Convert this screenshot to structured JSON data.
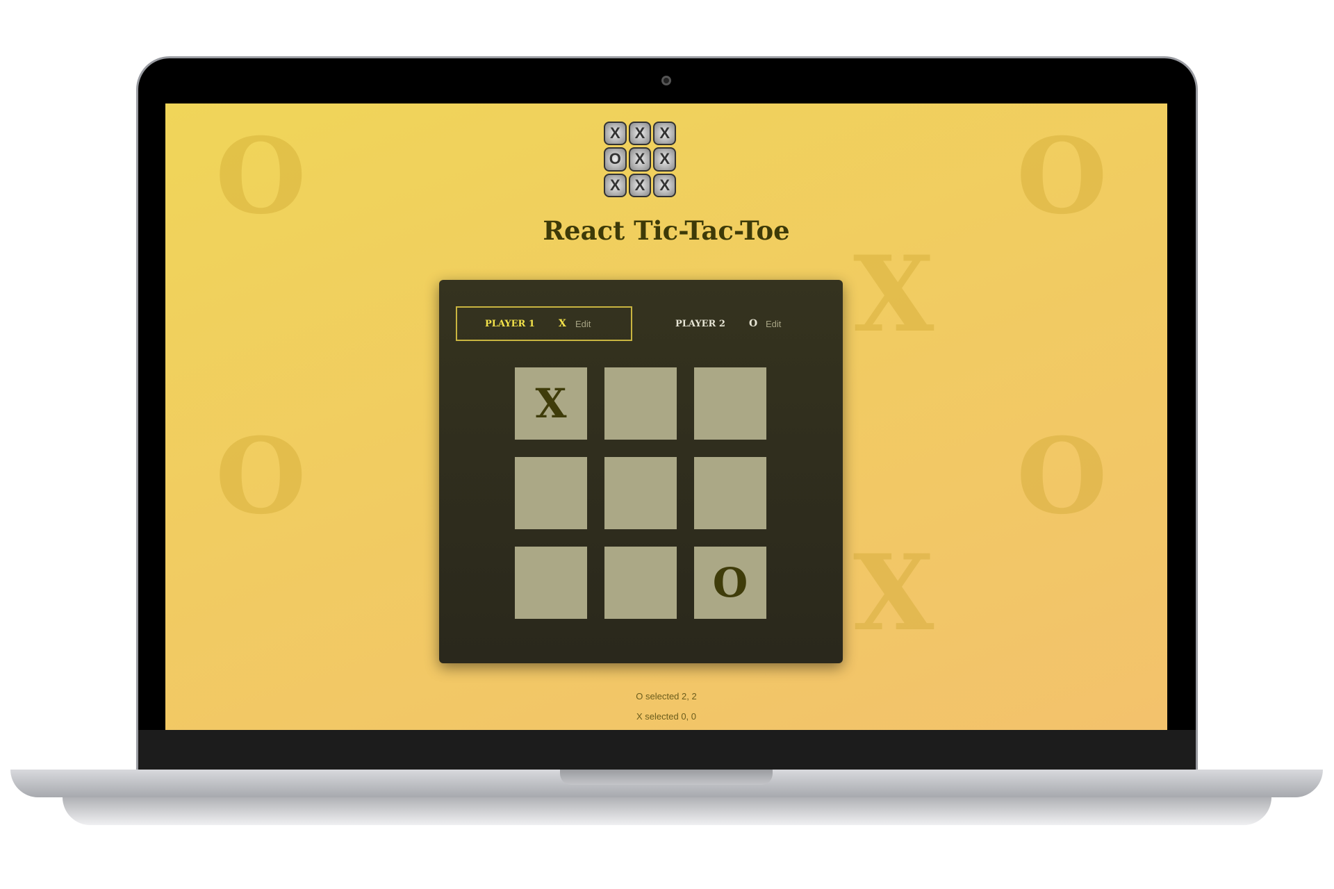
{
  "app": {
    "title": "React Tic-Tac-Toe",
    "logo_cells": [
      "X",
      "X",
      "X",
      "O",
      "X",
      "X",
      "X",
      "X",
      "X"
    ]
  },
  "players": [
    {
      "name": "PLAYER 1",
      "symbol": "X",
      "edit_label": "Edit",
      "active": true
    },
    {
      "name": "PLAYER 2",
      "symbol": "O",
      "edit_label": "Edit",
      "active": false
    }
  ],
  "board": [
    [
      "X",
      "",
      ""
    ],
    [
      "",
      "",
      ""
    ],
    [
      "",
      "",
      "O"
    ]
  ],
  "log": [
    "O selected 2, 2",
    "X selected 0, 0"
  ],
  "colors": {
    "accent": "#f3e24a",
    "panel": "#2f2d1f",
    "cell": "#aba886",
    "symbol": "#3f3c0a"
  }
}
